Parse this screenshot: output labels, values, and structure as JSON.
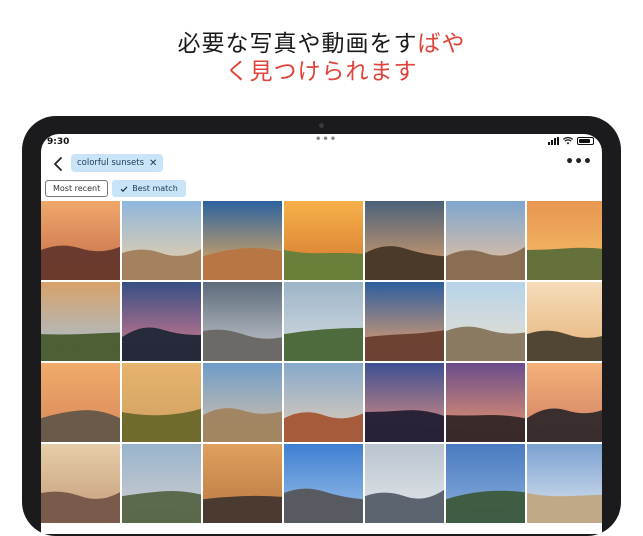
{
  "headline": {
    "line1": "必要な写真や動画をす",
    "line1_accent": "ばや",
    "line2_accent": "く見つけられます",
    "accent_color": "#e0433a"
  },
  "status_bar": {
    "time": "9:30"
  },
  "search": {
    "back_icon": "chevron-left-icon",
    "query_chip": "colorful sunsets",
    "clear_icon": "close-icon",
    "more_icon": "more-horizontal-icon"
  },
  "filters": [
    {
      "label": "Most recent",
      "selected": false
    },
    {
      "label": "Best match",
      "selected": true,
      "icon": "checkmark-icon"
    }
  ],
  "photos": [
    {
      "name": "balloons-over-valley-sunset",
      "sky": [
        "#f0a86a",
        "#c26a4a"
      ],
      "ground": "#6b3a2e"
    },
    {
      "name": "canyon-dusk",
      "sky": [
        "#8fb7de",
        "#f2d2a2"
      ],
      "ground": "#a4825f"
    },
    {
      "name": "balloon-canyon-sunrise",
      "sky": [
        "#2c62a0",
        "#f3b15a"
      ],
      "ground": "#b87644"
    },
    {
      "name": "portrait-golden-hour",
      "sky": [
        "#f6b04a",
        "#d4762f"
      ],
      "ground": "#6a7f3b"
    },
    {
      "name": "balloons-twilight",
      "sky": [
        "#4a627a",
        "#e7a36a"
      ],
      "ground": "#4b3a2a"
    },
    {
      "name": "hillside-town-dusk",
      "sky": [
        "#7fa6cf",
        "#f0c39b"
      ],
      "ground": "#8a6e54"
    },
    {
      "name": "cappadocia-sunset",
      "sky": [
        "#e8964f",
        "#f5c06a"
      ],
      "ground": "#65713a"
    },
    {
      "name": "woman-watching-balloons",
      "sky": [
        "#d6a26a",
        "#a7c1d9"
      ],
      "ground": "#4d5f35"
    },
    {
      "name": "pink-cloud-dusk",
      "sky": [
        "#354f84",
        "#e07c8f"
      ],
      "ground": "#262a3a"
    },
    {
      "name": "rocky-mountain-hiker",
      "sky": [
        "#5d6b7b",
        "#c9ccd1"
      ],
      "ground": "#6c6a66"
    },
    {
      "name": "mountain-village-house",
      "sky": [
        "#9db5c9",
        "#d7dde0"
      ],
      "ground": "#4d6b3c"
    },
    {
      "name": "canyon-reflection-dawn",
      "sky": [
        "#2d5e9f",
        "#f1a46a"
      ],
      "ground": "#6d4233"
    },
    {
      "name": "cathedral-on-hill",
      "sky": [
        "#b7d4ea",
        "#eadfce"
      ],
      "ground": "#8b7a62"
    },
    {
      "name": "joshua-trees-dusk",
      "sky": [
        "#f4dcb8",
        "#e8b37a"
      ],
      "ground": "#514634"
    },
    {
      "name": "balloon-basket-closeup",
      "sky": [
        "#f0ab6a",
        "#d8875a"
      ],
      "ground": "#6a5a4a"
    },
    {
      "name": "dog-in-meadow",
      "sky": [
        "#e7b46e",
        "#cfa060"
      ],
      "ground": "#6f6b2c"
    },
    {
      "name": "desert-palace-figure",
      "sky": [
        "#6f9cc9",
        "#d8c3a6"
      ],
      "ground": "#a28663"
    },
    {
      "name": "red-roof-town",
      "sky": [
        "#86a9cb",
        "#e6cfb8"
      ],
      "ground": "#a65b3b"
    },
    {
      "name": "joshua-tree-purple-sky",
      "sky": [
        "#3e4f94",
        "#e6937e"
      ],
      "ground": "#2a2236"
    },
    {
      "name": "joshua-tree-sunset",
      "sky": [
        "#6a4d8d",
        "#f09a6a"
      ],
      "ground": "#3a2a2a"
    },
    {
      "name": "joshua-tree-orange-dusk",
      "sky": [
        "#f4b27a",
        "#d07e62"
      ],
      "ground": "#3b2e2e"
    },
    {
      "name": "friends-selfie",
      "sky": [
        "#e5cda8",
        "#c59b7a"
      ],
      "ground": "#7a5a4a"
    },
    {
      "name": "palm-valley",
      "sky": [
        "#98b4cc",
        "#d3ced0"
      ],
      "ground": "#5b6a4c"
    },
    {
      "name": "couple-portrait",
      "sky": [
        "#e0a05f",
        "#b8763f"
      ],
      "ground": "#4a3a30"
    },
    {
      "name": "blue-sky-portrait",
      "sky": [
        "#3f7fd1",
        "#9ec3ea"
      ],
      "ground": "#585a62"
    },
    {
      "name": "misty-mountains",
      "sky": [
        "#b9c4cf",
        "#e5e8eb"
      ],
      "ground": "#5c6470"
    },
    {
      "name": "lakeside-blue-hour",
      "sky": [
        "#4a7ac0",
        "#8ab1dd"
      ],
      "ground": "#3f5d43"
    },
    {
      "name": "old-town-street",
      "sky": [
        "#7aa1d1",
        "#dfe7f0"
      ],
      "ground": "#c0a987"
    }
  ]
}
